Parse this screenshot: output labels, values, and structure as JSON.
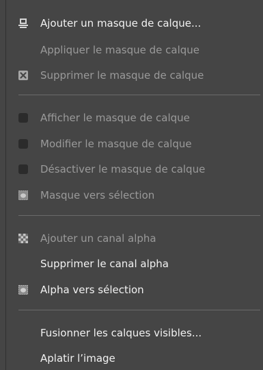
{
  "menu": {
    "items": [
      {
        "label": "Ajouter un masque de calque...",
        "icon": "add-layer-mask-icon",
        "enabled": true
      },
      {
        "label": "Appliquer le masque de calque",
        "icon": "",
        "enabled": false
      },
      {
        "label": "Supprimer le masque de calque",
        "icon": "delete-mask-icon",
        "enabled": false
      },
      {
        "label": "Afficher le masque de calque",
        "icon": "checkbox-icon",
        "enabled": false
      },
      {
        "label": "Modifier le masque de calque",
        "icon": "checkbox-icon",
        "enabled": false
      },
      {
        "label": "Désactiver le masque de calque",
        "icon": "checkbox-icon",
        "enabled": false
      },
      {
        "label": "Masque vers sélection",
        "icon": "mask-to-selection-icon",
        "enabled": false
      },
      {
        "label": "Ajouter un canal alpha",
        "icon": "alpha-channel-icon",
        "enabled": false
      },
      {
        "label": "Supprimer le canal alpha",
        "icon": "",
        "enabled": true
      },
      {
        "label": "Alpha vers sélection",
        "icon": "alpha-to-selection-icon",
        "enabled": true
      },
      {
        "label": "Fusionner les calques visibles...",
        "icon": "",
        "enabled": true
      },
      {
        "label": "Aplatir l’image",
        "icon": "",
        "enabled": true
      }
    ]
  },
  "colors": {
    "background": "#454545",
    "text_enabled": "#f2f2f2",
    "text_disabled": "#9a9a9a",
    "separator": "#6a6a6a"
  }
}
